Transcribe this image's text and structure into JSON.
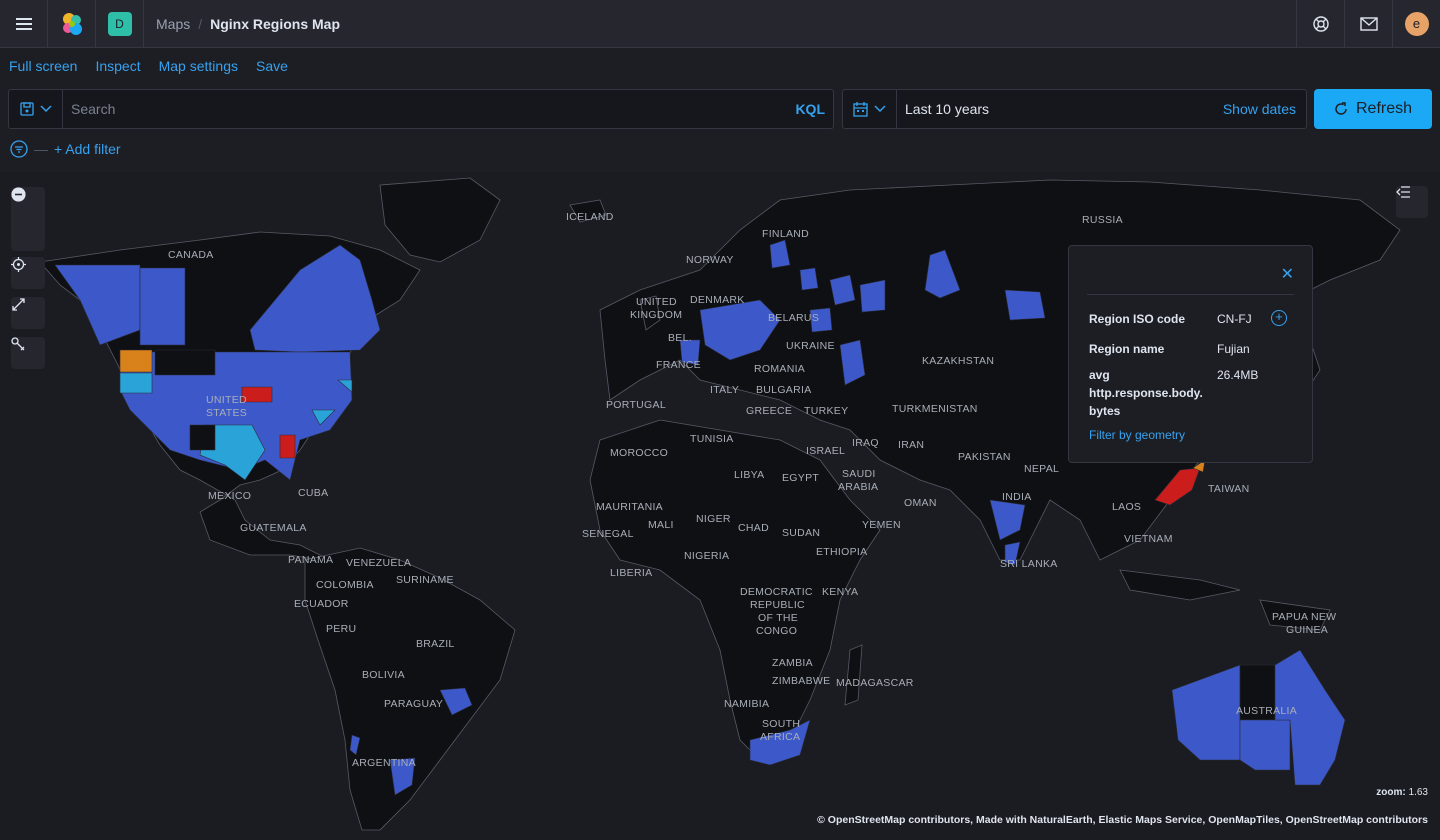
{
  "header": {
    "space_initial": "D",
    "breadcrumb_parent": "Maps",
    "breadcrumb_current": "Nginx Regions Map",
    "avatar_initial": "e"
  },
  "actions": [
    "Full screen",
    "Inspect",
    "Map settings",
    "Save"
  ],
  "query": {
    "placeholder": "Search",
    "language": "KQL"
  },
  "time": {
    "value": "Last 10 years",
    "show_dates": "Show dates",
    "refresh_label": "Refresh"
  },
  "filters": {
    "add_filter": "+ Add filter"
  },
  "tooltip": {
    "rows": [
      {
        "key": "Region ISO code",
        "value": "CN-FJ"
      },
      {
        "key": "Region name",
        "value": "Fujian"
      },
      {
        "key": "avg\nhttp.response.body.\nbytes",
        "value": "26.4MB"
      }
    ],
    "filter_link": "Filter by geometry"
  },
  "map": {
    "labels": [
      "ICELAND",
      "FINLAND",
      "RUSSIA",
      "CANADA",
      "NORWAY",
      "UNITED KINGDOM",
      "DENMARK",
      "BELARUS",
      "UKRAINE",
      "BEL.",
      "FRANCE",
      "ROMANIA",
      "KAZAKHSTAN",
      "PORTUGAL",
      "ITALY",
      "BULGARIA",
      "GREECE",
      "TURKEY",
      "TURKMENISTAN",
      "UNITED STATES",
      "MOROCCO",
      "TUNISIA",
      "IRAQ",
      "ISRAEL",
      "IRAN",
      "PAKISTAN",
      "NEPAL",
      "LIBYA",
      "EGYPT",
      "SAUDI ARABIA",
      "OMAN",
      "INDIA",
      "TAIWAN",
      "MEXICO",
      "CUBA",
      "MAURITANIA",
      "MALI",
      "NIGER",
      "CHAD",
      "SUDAN",
      "YEMEN",
      "LAOS",
      "GUATEMALA",
      "SENEGAL",
      "NIGERIA",
      "ETHIOPIA",
      "VIETNAM",
      "SRI LANKA",
      "PANAMA",
      "VENEZUELA",
      "LIBERIA",
      "COLOMBIA",
      "SURINAME",
      "ECUADOR",
      "DEMOCRATIC REPUBLIC OF THE CONGO",
      "KENYA",
      "PERU",
      "BRAZIL",
      "PAPUA NEW GUINEA",
      "ZAMBIA",
      "BOLIVIA",
      "ZIMBABWE",
      "MADAGASCAR",
      "PARAGUAY",
      "NAMIBIA",
      "SOUTH AFRICA",
      "AUSTRALIA",
      "ARGENTINA"
    ],
    "zoom_label": "zoom:",
    "zoom_value": "1.63",
    "attribution": "© OpenStreetMap contributors, Made with NaturalEarth, Elastic Maps Service, OpenMapTiles, OpenStreetMap contributors",
    "colors": {
      "low": "#3d58c9",
      "mid": "#2aa3d9",
      "high_orange": "#d9821c",
      "max": "#cc1d1d"
    }
  }
}
